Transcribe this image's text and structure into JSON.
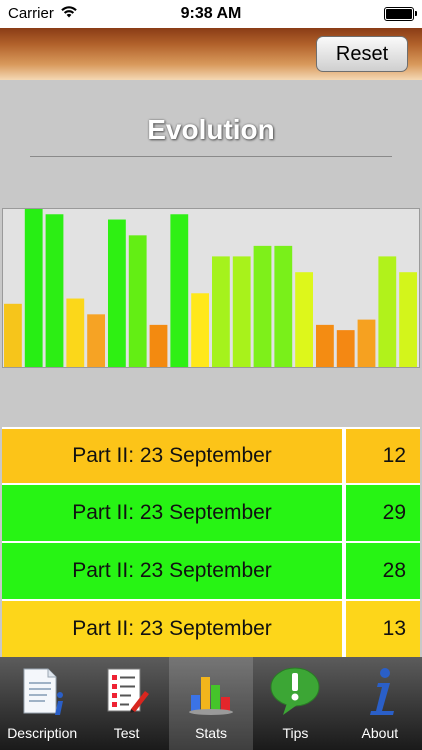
{
  "status_bar": {
    "carrier": "Carrier",
    "time": "9:38 AM",
    "battery_level": 1.0
  },
  "nav_bar": {
    "reset_label": "Reset"
  },
  "page": {
    "title": "Evolution"
  },
  "chart_data": {
    "type": "bar",
    "title": "Evolution",
    "xlabel": "",
    "ylabel": "",
    "ylim": [
      0,
      30
    ],
    "grid": false,
    "legend": "none",
    "values": [
      12,
      30,
      29,
      13,
      10,
      28,
      25,
      8,
      29,
      14,
      21,
      21,
      23,
      23,
      18,
      8,
      7,
      9,
      21,
      18
    ],
    "bar_colors": [
      "#f6c51b",
      "#27ee14",
      "#2cee14",
      "#fbd71a",
      "#f6a324",
      "#2ef012",
      "#63ee14",
      "#f38a10",
      "#2ff015",
      "#ffe81a",
      "#a5f21c",
      "#a8f21b",
      "#7ef01a",
      "#79f01a",
      "#ddf71b",
      "#f48c12",
      "#f48813",
      "#f6a120",
      "#b1f21b",
      "#d3f51b"
    ]
  },
  "table": {
    "rows": [
      {
        "date": "Part II: 23 September",
        "score": "12",
        "color": "#fcc418"
      },
      {
        "date": "Part II: 23 September",
        "score": "29",
        "color": "#27f414"
      },
      {
        "date": "Part II: 23 September",
        "score": "28",
        "color": "#27f414"
      },
      {
        "date": "Part II: 23 September",
        "score": "13",
        "color": "#fdd61a"
      }
    ]
  },
  "tab_bar": {
    "tabs": [
      {
        "label": "Description",
        "icon": "document-info-icon",
        "active": false
      },
      {
        "label": "Test",
        "icon": "checklist-icon",
        "active": false
      },
      {
        "label": "Stats",
        "icon": "bar-chart-icon",
        "active": true
      },
      {
        "label": "Tips",
        "icon": "speech-bubble-exclamation-icon",
        "active": false
      },
      {
        "label": "About",
        "icon": "info-icon",
        "active": false
      }
    ]
  }
}
